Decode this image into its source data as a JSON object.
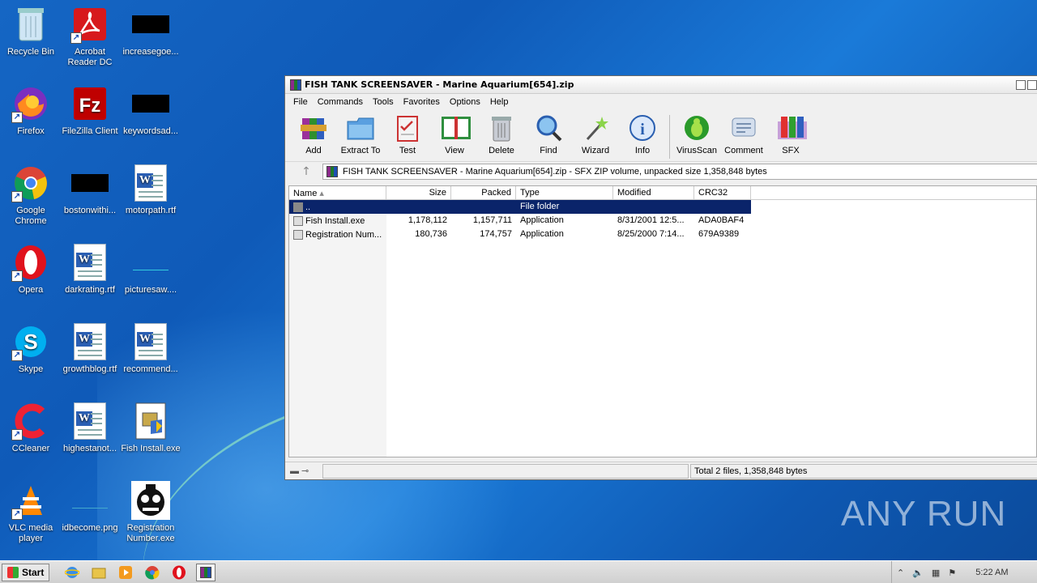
{
  "desktop": {
    "icons": [
      {
        "label": "Recycle Bin"
      },
      {
        "label": "Acrobat Reader DC"
      },
      {
        "label": "increasegoe..."
      },
      {
        "label": "Firefox"
      },
      {
        "label": "FileZilla Client"
      },
      {
        "label": "keywordsad..."
      },
      {
        "label": "Google Chrome"
      },
      {
        "label": "bostonwithi..."
      },
      {
        "label": "motorpath.rtf"
      },
      {
        "label": "Opera"
      },
      {
        "label": "darkrating.rtf"
      },
      {
        "label": "picturesaw...."
      },
      {
        "label": "Skype"
      },
      {
        "label": "growthblog.rtf"
      },
      {
        "label": "recommend..."
      },
      {
        "label": "CCleaner"
      },
      {
        "label": "highestanot..."
      },
      {
        "label": "Fish Install.exe"
      },
      {
        "label": "VLC media player"
      },
      {
        "label": "idbecome.png"
      },
      {
        "label": "Registration Number.exe"
      }
    ]
  },
  "window": {
    "title": "FISH TANK SCREENSAVER - Marine Aquarium[654].zip",
    "menu": [
      "File",
      "Commands",
      "Tools",
      "Favorites",
      "Options",
      "Help"
    ],
    "toolbar": [
      {
        "label": "Add",
        "icon": "add-archive-icon"
      },
      {
        "label": "Extract To",
        "icon": "extract-folder-icon"
      },
      {
        "label": "Test",
        "icon": "test-clipboard-icon"
      },
      {
        "label": "View",
        "icon": "view-book-icon"
      },
      {
        "label": "Delete",
        "icon": "trash-icon"
      },
      {
        "label": "Find",
        "icon": "magnifier-icon"
      },
      {
        "label": "Wizard",
        "icon": "wand-icon"
      },
      {
        "label": "Info",
        "icon": "info-icon"
      },
      {
        "label": "VirusScan",
        "icon": "bug-icon"
      },
      {
        "label": "Comment",
        "icon": "comment-icon"
      },
      {
        "label": "SFX",
        "icon": "sfx-archive-icon"
      }
    ],
    "address": "FISH TANK SCREENSAVER - Marine Aquarium[654].zip - SFX ZIP volume, unpacked size 1,358,848 bytes",
    "columns": {
      "name": "Name",
      "size": "Size",
      "packed": "Packed",
      "type": "Type",
      "modified": "Modified",
      "crc": "CRC32"
    },
    "rows": [
      {
        "name": "..",
        "size": "",
        "packed": "",
        "type": "File folder",
        "modified": "",
        "crc": ""
      },
      {
        "name": "Fish Install.exe",
        "size": "1,178,112",
        "packed": "1,157,711",
        "type": "Application",
        "modified": "8/31/2001 12:5...",
        "crc": "ADA0BAF4"
      },
      {
        "name": "Registration Num...",
        "size": "180,736",
        "packed": "174,757",
        "type": "Application",
        "modified": "8/25/2000 7:14...",
        "crc": "679A9389"
      }
    ],
    "status": "Total 2 files, 1,358,848 bytes"
  },
  "taskbar": {
    "start": "Start",
    "clock": "5:22 AM"
  },
  "watermark": "ANY RUN"
}
